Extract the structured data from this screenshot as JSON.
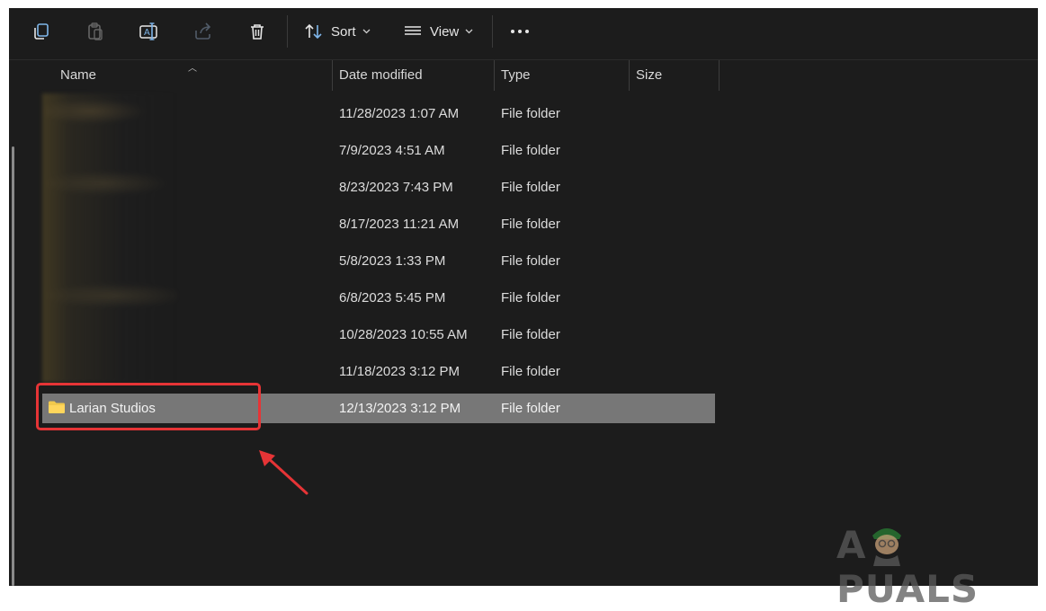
{
  "toolbar": {
    "sort_label": "Sort",
    "view_label": "View",
    "icons": [
      "copy-icon",
      "paste-icon",
      "rename-icon",
      "share-icon",
      "delete-icon",
      "sort-icon",
      "view-icon",
      "more-icon"
    ]
  },
  "columns": {
    "name": "Name",
    "date_modified": "Date modified",
    "type": "Type",
    "size": "Size"
  },
  "rows": [
    {
      "name": "",
      "date": "11/28/2023 1:07 AM",
      "type": "File folder"
    },
    {
      "name": "",
      "date": "7/9/2023 4:51 AM",
      "type": "File folder"
    },
    {
      "name": "",
      "date": "8/23/2023 7:43 PM",
      "type": "File folder"
    },
    {
      "name": "",
      "date": "8/17/2023 11:21 AM",
      "type": "File folder"
    },
    {
      "name": "",
      "date": "5/8/2023 1:33 PM",
      "type": "File folder"
    },
    {
      "name": "",
      "date": "6/8/2023 5:45 PM",
      "type": "File folder"
    },
    {
      "name": "",
      "date": "10/28/2023 10:55 AM",
      "type": "File folder"
    },
    {
      "name": "",
      "date": "11/18/2023 3:12 PM",
      "type": "File folder"
    },
    {
      "name": "Larian Studios",
      "date": "12/13/2023 3:12 PM",
      "type": "File folder"
    }
  ],
  "colors": {
    "background": "#1c1c1c",
    "selected_row": "#777777",
    "annotation": "#e63436",
    "folder": "#f2c94c"
  },
  "watermark": {
    "text_left": "A",
    "text_right": "PUALS"
  }
}
